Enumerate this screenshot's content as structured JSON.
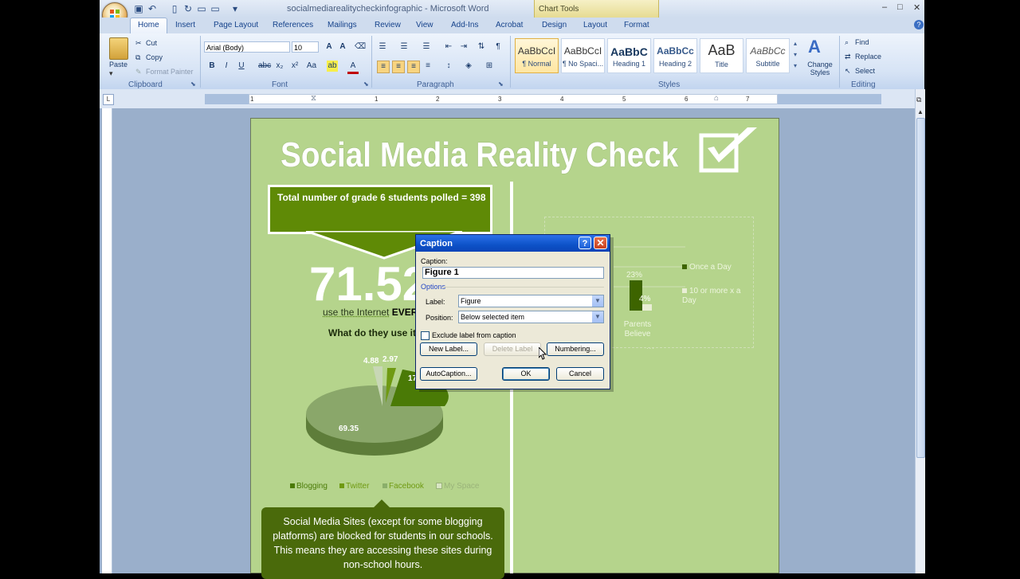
{
  "app": {
    "doc_title": "socialmediarealitycheckinfographic - Microsoft Word",
    "context_tab_group": "Chart Tools"
  },
  "tabs": [
    "Home",
    "Insert",
    "Page Layout",
    "References",
    "Mailings",
    "Review",
    "View",
    "Add-Ins",
    "Acrobat",
    "Design",
    "Layout",
    "Format"
  ],
  "ribbon": {
    "clipboard": {
      "paste": "Paste",
      "cut": "Cut",
      "copy": "Copy",
      "format_painter": "Format Painter",
      "group": "Clipboard"
    },
    "font": {
      "family": "Arial (Body)",
      "size": "10",
      "group": "Font"
    },
    "paragraph": {
      "group": "Paragraph"
    },
    "styles": {
      "group": "Styles",
      "tiles": [
        {
          "sample": "AaBbCcI",
          "name": "¶ Normal"
        },
        {
          "sample": "AaBbCcI",
          "name": "¶ No Spaci..."
        },
        {
          "sample": "AaBbC",
          "name": "Heading 1"
        },
        {
          "sample": "AaBbCc",
          "name": "Heading 2"
        },
        {
          "sample": "AaB",
          "name": "Title"
        },
        {
          "sample": "AaBbCc",
          "name": "Subtitle"
        }
      ],
      "change_styles": "Change Styles"
    },
    "editing": {
      "find": "Find",
      "replace": "Replace",
      "select": "Select",
      "group": "Editing"
    }
  },
  "ruler_numbers": [
    "1",
    "1",
    "2",
    "3",
    "4",
    "5",
    "6",
    "7"
  ],
  "infographic": {
    "title": "Social Media Reality Check",
    "callout": "Total number of grade 6 students polled = 398",
    "big_pct": "71.52",
    "use_prefix": "use the Internet",
    "use_bold": "EVER",
    "question": "What do they use it",
    "pie_values": {
      "blogging_val": "4.88",
      "twitter_val": "2.97",
      "facebook_val": "17",
      "myspace_val": "69.35"
    },
    "legend": [
      {
        "label": "Blogging",
        "color": "#4a7a06"
      },
      {
        "label": "Twitter",
        "color": "#6f9a12"
      },
      {
        "label": "Facebook",
        "color": "#8aae6a"
      },
      {
        "label": "My Space",
        "color": "#d9e6c4"
      }
    ],
    "bubble": "Social Media Sites (except for some blogging platforms) are blocked for students in our schools. This means they are accessing these sites during non-school hours.",
    "right_chart": {
      "pct": "23%",
      "pct2": "4%",
      "axis_label": "Parents Believe",
      "legend1": "Once a Day",
      "legend2": "10 or more x a Day"
    }
  },
  "chart_data": {
    "type": "pie",
    "title": "",
    "categories": [
      "Blogging",
      "Twitter",
      "Facebook",
      "My Space"
    ],
    "values": [
      4.88,
      2.97,
      17,
      69.35
    ]
  },
  "dialog": {
    "title": "Caption",
    "caption_label": "Caption:",
    "caption_value": "Figure 1",
    "options_label": "Options",
    "label_label": "Label:",
    "label_value": "Figure",
    "position_label": "Position:",
    "position_value": "Below selected item",
    "exclude_label": "Exclude label from caption",
    "new_label": "New Label...",
    "delete_label": "Delete Label",
    "numbering": "Numbering...",
    "autocaption": "AutoCaption...",
    "ok": "OK",
    "cancel": "Cancel"
  }
}
